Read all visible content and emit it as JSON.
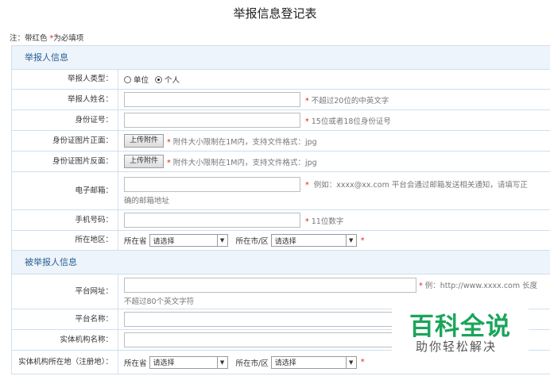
{
  "title": "举报信息登记表",
  "note": {
    "prefix": "注：带红色 ",
    "star": "*",
    "suffix": "为必填项"
  },
  "sections": {
    "reporter": "举报人信息",
    "reported": "被举报人信息"
  },
  "reporter": {
    "type_label": "举报人类型：",
    "type_options": [
      "单位",
      "个人"
    ],
    "type_selected": "个人",
    "name_label": "举报人姓名：",
    "name_hint": "不超过20位的中英文字",
    "id_label": "身份证号：",
    "id_hint": "15位或者18位身份证号",
    "id_front_label": "身份证图片正面：",
    "id_back_label": "身份证图片反面：",
    "upload_button": "上传附件",
    "upload_hint": "附件大小限制在1M内，支持文件格式：jpg",
    "email_label": "电子邮箱：",
    "email_hint": "例如：xxxx@xx.com 平台会通过邮箱发送相关通知，请填写正",
    "email_hint_cont": "确的邮箱地址",
    "phone_label": "手机号码：",
    "phone_hint": "11位数字",
    "region_label": "所在地区：",
    "province_label": "所在省",
    "city_label": "所在市/区",
    "select_placeholder": "请选择"
  },
  "reported": {
    "url_label": "平台网址：",
    "url_hint": "例：http://www.xxxx.com 长度",
    "url_hint_cont": "不超过80个英文字符",
    "platform_name_label": "平台名称：",
    "entity_name_label": "实体机构名称：",
    "entity_location_label": "实体机构所在地（注册地）：",
    "province_label": "所在省",
    "city_label": "所在市/区",
    "select_placeholder": "请选择"
  },
  "required_mark": "*",
  "watermark": {
    "title": "百科全说",
    "subtitle": "助你轻松解决"
  },
  "colors": {
    "required": "#e02020",
    "section_bg": "#edf4fb",
    "section_text": "#2a5f93",
    "border": "#cfe0ee",
    "watermark": "#1aa55a"
  }
}
